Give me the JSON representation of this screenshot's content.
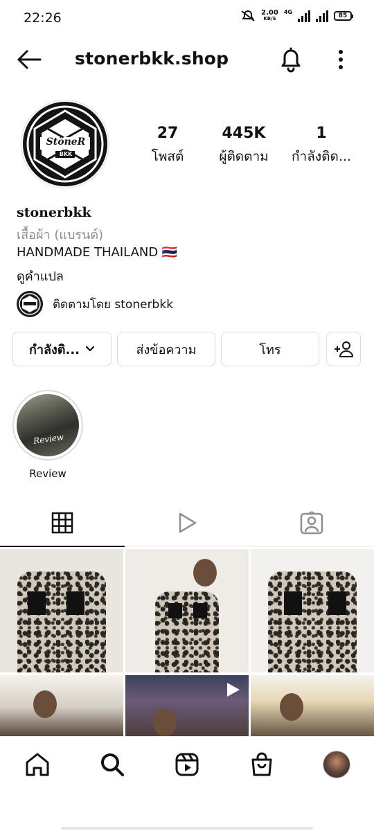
{
  "status_bar": {
    "time": "22:26",
    "net_speed": "2.00",
    "net_unit": "KB/S",
    "network": "4G",
    "battery": "85"
  },
  "header": {
    "username": "stonerbkk.shop",
    "back_icon": "arrow-left-icon",
    "bell_icon": "bell-icon",
    "more_icon": "more-vertical-icon"
  },
  "profile": {
    "logo_text": "StöneR",
    "logo_sub": "BKK",
    "stats": [
      {
        "value": "27",
        "label": "โพสต์"
      },
      {
        "value": "445K",
        "label": "ผู้ติดตาม"
      },
      {
        "value": "1",
        "label": "กำลังติด..."
      }
    ],
    "bio": {
      "name": "stonerbkk",
      "category": "เสื้อผ้า (แบรนด์)",
      "line": "HANDMADE THAILAND 🇹🇭",
      "translate": "ดูคำแปล"
    },
    "followed_by": "ติดตามโดย stonerbkk"
  },
  "actions": {
    "following": "กำลังติ...",
    "message": "ส่งข้อความ",
    "call": "โทร",
    "add_user_icon": "add-person-icon"
  },
  "highlights": [
    {
      "label": "Review",
      "cover_text": "Review"
    }
  ],
  "tabs": [
    {
      "icon": "grid-icon",
      "active": true
    },
    {
      "icon": "reels-icon",
      "active": false
    },
    {
      "icon": "tagged-icon",
      "active": false
    }
  ],
  "bottom_nav": [
    {
      "icon": "home-icon"
    },
    {
      "icon": "search-icon"
    },
    {
      "icon": "reels-nav-icon"
    },
    {
      "icon": "shop-icon"
    },
    {
      "icon": "profile-avatar"
    }
  ],
  "colors": {
    "text": "#111111",
    "muted": "#8e8e8e",
    "border": "#dbdbdb",
    "flag_red": "#a51931",
    "flag_blue": "#2d2a4a"
  }
}
